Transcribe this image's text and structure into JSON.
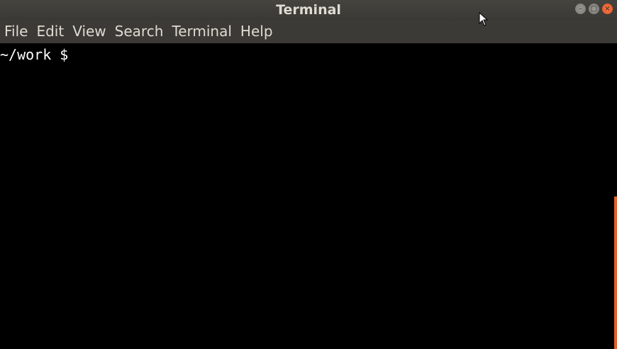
{
  "window": {
    "title": "Terminal",
    "controls": {
      "minimize_icon": "minimize-icon",
      "maximize_icon": "maximize-icon",
      "close_icon": "close-icon"
    }
  },
  "menu": {
    "items": [
      "File",
      "Edit",
      "View",
      "Search",
      "Terminal",
      "Help"
    ]
  },
  "terminal": {
    "prompt": "~/work $ "
  },
  "colors": {
    "titlebar": "#3c3b37",
    "accent": "#e0632f",
    "text": "#dfdbd2",
    "terminal_bg": "#000000"
  }
}
